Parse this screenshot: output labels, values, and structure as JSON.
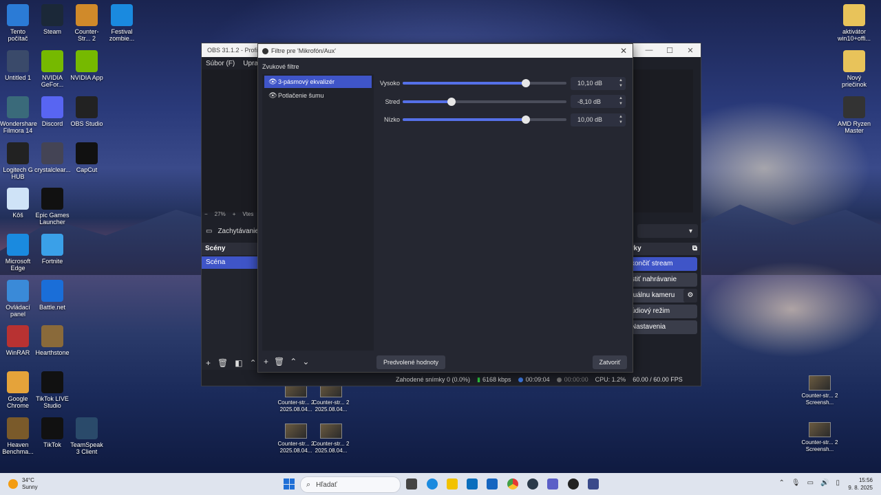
{
  "desktop": {
    "icons": [
      {
        "label": "Tento počítač"
      },
      {
        "label": "Steam"
      },
      {
        "label": "Counter-Str... 2"
      },
      {
        "label": "Festival zombie..."
      },
      {
        "label": "Untitled 1"
      },
      {
        "label": "NVIDIA GeFor..."
      },
      {
        "label": "NVIDIA App"
      },
      {
        "label": "Wondershare Filmora 14"
      },
      {
        "label": "Discord"
      },
      {
        "label": "OBS Studio"
      },
      {
        "label": "Logitech G HUB"
      },
      {
        "label": "crystalclear..."
      },
      {
        "label": "CapCut"
      },
      {
        "label": "Kôš"
      },
      {
        "label": "Epic Games Launcher"
      },
      {
        "label": "Microsoft Edge"
      },
      {
        "label": "Fortnite"
      },
      {
        "label": "Ovládací panel"
      },
      {
        "label": "Battle.net"
      },
      {
        "label": "WinRAR"
      },
      {
        "label": "Hearthstone"
      },
      {
        "label": "Google Chrome"
      },
      {
        "label": "TikTok LIVE Studio"
      },
      {
        "label": "Heaven Benchma..."
      },
      {
        "label": "TikTok"
      },
      {
        "label": "TeamSpeak 3 Client"
      },
      {
        "label": "aktivátor win10+offi..."
      },
      {
        "label": "Nový priečinok"
      },
      {
        "label": "AMD Ryzen Master"
      }
    ],
    "recordings": [
      {
        "label": "Counter-str... 2 2025.08.04..."
      },
      {
        "label": "Counter-str... 2 2025.08.04..."
      },
      {
        "label": "Counter-str... 2 2025.08.04..."
      },
      {
        "label": "Counter-str... 2 2025.08.04..."
      },
      {
        "label": "Counter-str... 2 Screensh..."
      },
      {
        "label": "Counter-str... 2 Screensh..."
      }
    ]
  },
  "obs": {
    "title": "OBS 31.1.2 - Profi",
    "menu": [
      "Súbor (F)",
      "Upraviť"
    ],
    "zoom": "27%",
    "zoom_extra": "Vtes",
    "source_label": "Zachytávanie",
    "scenes_header": "Scény",
    "scene_item": "Scéna",
    "controls_header": "vky",
    "controls": [
      "končiť stream",
      "stiť nahrávanie",
      "tuálnu kameru",
      "údiový režim",
      "Nastavenia"
    ],
    "status": {
      "dropped": "Zahodené snímky 0 (0.0%)",
      "bitrate": "6168 kbps",
      "stream_time": "00:09:04",
      "rec_time": "00:00:00",
      "cpu": "CPU: 1.2%",
      "fps": "60.00 / 60.00 FPS"
    }
  },
  "filter_dialog": {
    "title": "Filtre pre 'Mikrofón/Aux'",
    "group_label": "Zvukové filtre",
    "filters": [
      {
        "name": "3-pásmový ekvalizér",
        "selected": true
      },
      {
        "name": "Potlačenie šumu",
        "selected": false
      }
    ],
    "bands": [
      {
        "label": "Vysoko",
        "value_text": "10,10 dB",
        "value": 10.1
      },
      {
        "label": "Stred",
        "value_text": "-8,10 dB",
        "value": -8.1
      },
      {
        "label": "Nízko",
        "value_text": "10,00 dB",
        "value": 10.0
      }
    ],
    "band_range": [
      -20,
      20
    ],
    "defaults_button": "Predvolené hodnoty",
    "close_button": "Zatvoriť",
    "accent": "#3f55c8"
  },
  "taskbar": {
    "weather_temp": "34°C",
    "weather_desc": "Sunny",
    "search_placeholder": "Hľadať",
    "time": "15:56",
    "date": "9. 8. 2025"
  }
}
